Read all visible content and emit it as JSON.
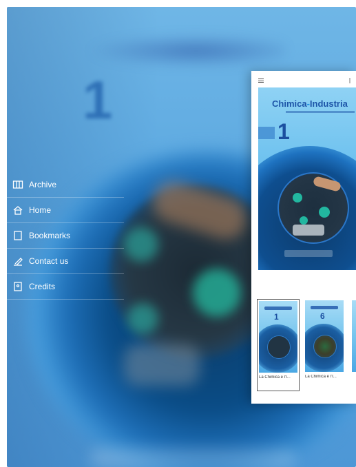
{
  "menu": {
    "items": [
      {
        "label": "Archive",
        "icon": "archive-icon"
      },
      {
        "label": "Home",
        "icon": "home-icon"
      },
      {
        "label": "Bookmarks",
        "icon": "bookmark-icon"
      },
      {
        "label": "Contact us",
        "icon": "contact-icon"
      },
      {
        "label": "Credits",
        "icon": "credits-icon"
      }
    ]
  },
  "reader": {
    "cover": {
      "brand_part1": "Chimica",
      "brand_part2": "Industria",
      "issue_number": "1"
    },
    "thumbnails": [
      {
        "label": "La Chimica e l'I...",
        "issue": "1",
        "selected": true
      },
      {
        "label": "La Chimica e l'I...",
        "issue": "6",
        "selected": false
      }
    ]
  },
  "colors": {
    "background_blue": "#5aa7e0",
    "brand_blue": "#1d55a8",
    "accent_teal": "#24b39a"
  }
}
